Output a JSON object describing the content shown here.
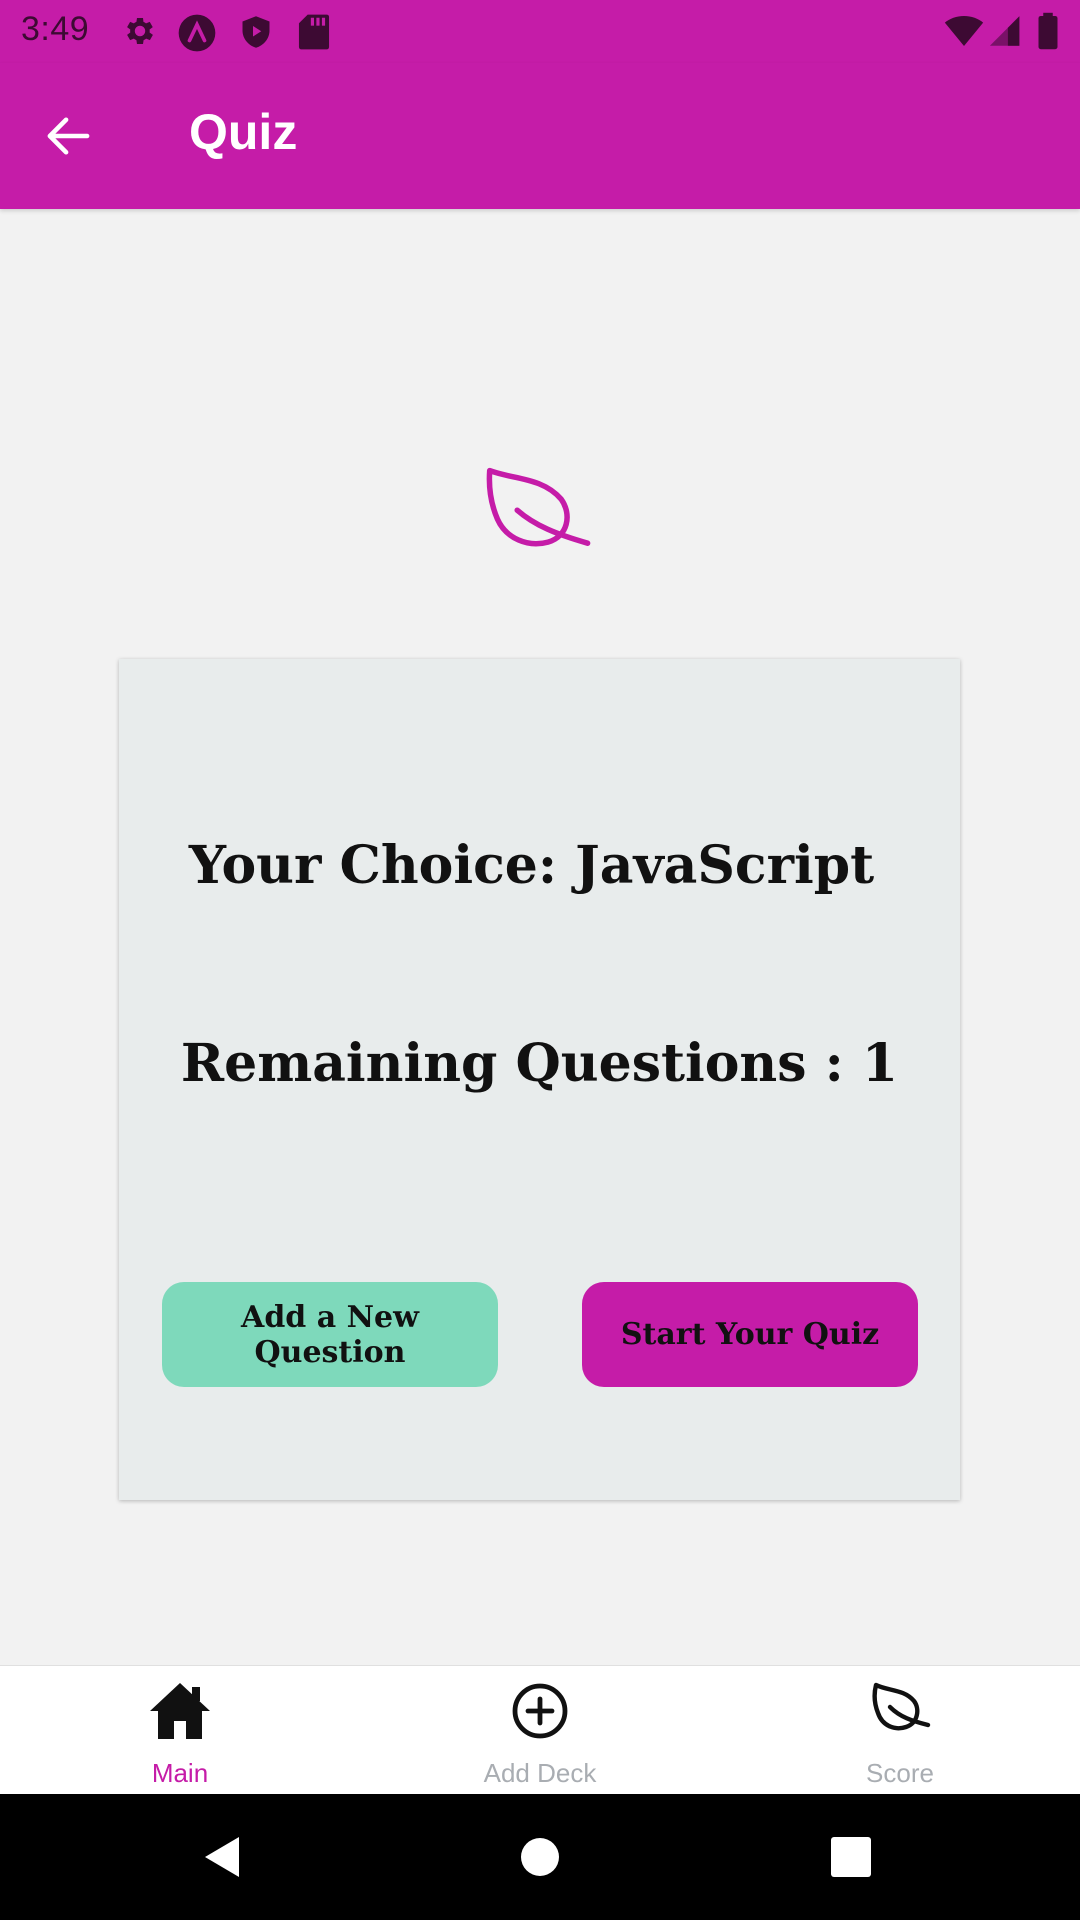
{
  "status_bar": {
    "time": "3:49"
  },
  "app_bar": {
    "title": "Quiz",
    "back_icon": "arrow-left-icon"
  },
  "hero": {
    "icon": "leaf-icon"
  },
  "card": {
    "choice_text": "Your Choice: JavaScript",
    "remaining_text": "Remaining Questions : 1",
    "add_question_label": "Add a New Question",
    "start_quiz_label": "Start Your Quiz"
  },
  "tabs": [
    {
      "label": "Main",
      "icon": "home-icon",
      "active": true
    },
    {
      "label": "Add Deck",
      "icon": "plus-circle-icon",
      "active": false
    },
    {
      "label": "Score",
      "icon": "leaf-icon",
      "active": false
    }
  ],
  "colors": {
    "primary": "#c51ca8",
    "secondary": "#7ed9bb",
    "card_bg": "#e8ecec",
    "page_bg": "#f2f2f2",
    "tab_active": "#c51ca8",
    "tab_inactive": "#a9adb2"
  }
}
